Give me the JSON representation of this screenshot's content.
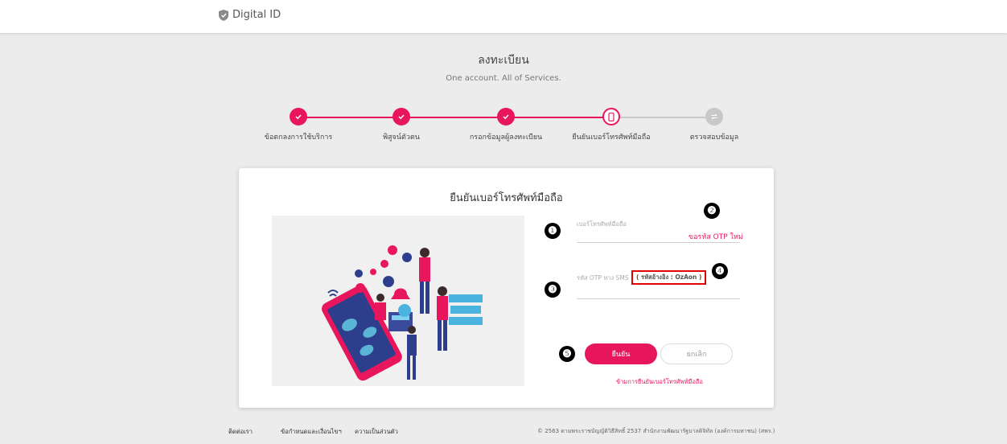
{
  "header": {
    "brand": "Digital ID",
    "brand_icon": "shield-icon"
  },
  "page": {
    "title": "ลงทะเบียน",
    "subtitle": "One account. All of Services."
  },
  "steps": [
    {
      "label": "ข้อตกลงการใช้บริการ",
      "state": "done",
      "icon": "check-icon"
    },
    {
      "label": "พิสูจน์ตัวตน",
      "state": "done",
      "icon": "check-icon"
    },
    {
      "label": "กรอกข้อมูลผู้ลงทะเบียน",
      "state": "done",
      "icon": "check-icon"
    },
    {
      "label": "ยืนยันเบอร์โทรศัพท์มือถือ",
      "state": "current",
      "icon": "phone-icon"
    },
    {
      "label": "ตรวจสอบข้อมูล",
      "state": "todo",
      "icon": "exchange-icon"
    }
  ],
  "card": {
    "title": "ยืนยันเบอร์โทรศัพท์มือถือ",
    "phone_label": "เบอร์โทรศัพท์มือถือ",
    "request_otp": "ขอรหัส OTP ใหม่",
    "otp_label": "รหัส OTP ทาง SMS",
    "ref_code": "( รหัสอ้างอิง : OzAon )",
    "confirm": "ยืนยัน",
    "cancel": "ยกเลิก",
    "skip": "ข้ามการยืนยันเบอร์โทรศัพท์มือถือ"
  },
  "markers": [
    "❶",
    "❷",
    "❸",
    "❹",
    "❺"
  ],
  "footer": {
    "links": [
      "ติดต่อเรา",
      "ข้อกำหนดและเงื่อนไขฯ",
      "ความเป็นส่วนตัว"
    ],
    "copyright": "© 2563 ตามพระราชบัญญัติวิธีสิทธิ์ 2537 สำนักงานพัฒนารัฐบาลดิจิทัล (องค์การมหาชน) (สพร.)"
  },
  "colors": {
    "accent": "#e8175d",
    "inactive": "#c8c8c8",
    "background": "#ececec"
  }
}
